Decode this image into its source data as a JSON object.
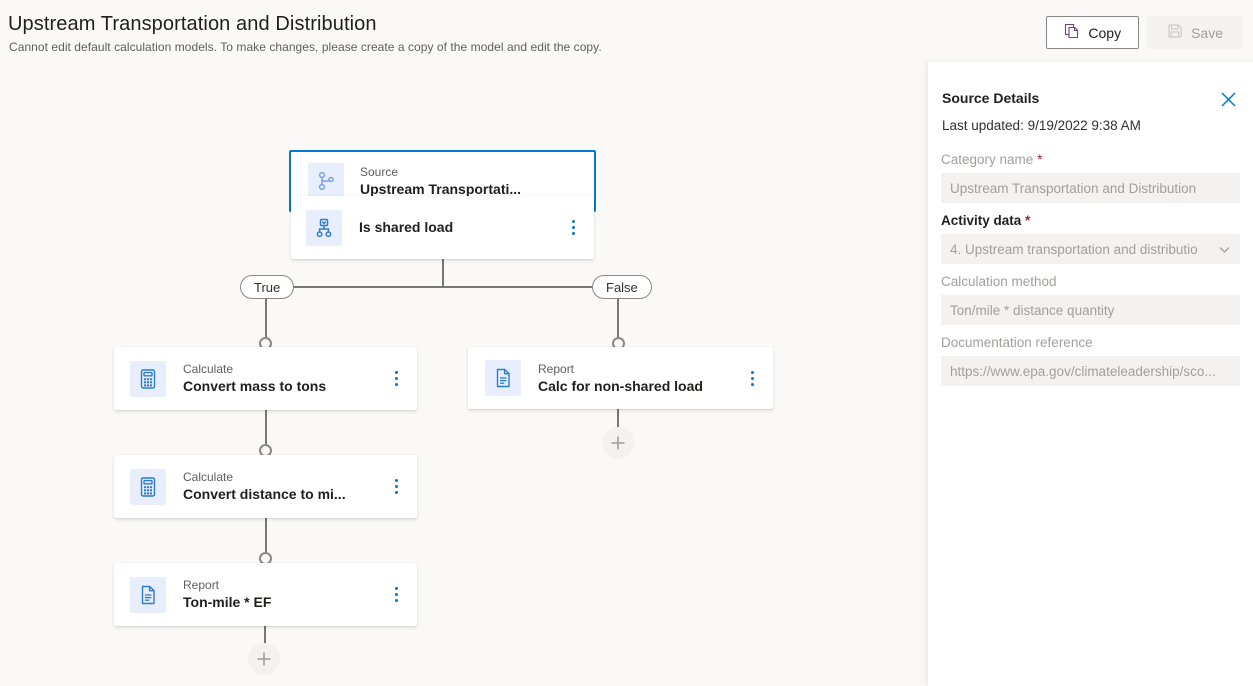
{
  "header": {
    "title": "Upstream Transportation and Distribution",
    "subtitle": "Cannot edit default calculation models. To make changes, please create a copy of the model and edit the copy.",
    "copy_label": "Copy",
    "save_label": "Save",
    "copy_icon": "copy-icon",
    "save_icon": "save-floppy-icon"
  },
  "flow": {
    "nodes": [
      {
        "id": "source",
        "kind": "Source",
        "name": "Upstream Transportati...",
        "icon": "branch-source-icon",
        "selected": true,
        "has_menu": false
      },
      {
        "id": "decision",
        "kind": "",
        "name": "Is shared load",
        "icon": "decision-branch-icon",
        "selected": false,
        "has_menu": true
      },
      {
        "id": "calc1",
        "kind": "Calculate",
        "name": "Convert mass to tons",
        "icon": "calculator-icon",
        "selected": false,
        "has_menu": true
      },
      {
        "id": "calc2",
        "kind": "Calculate",
        "name": "Convert distance to mi...",
        "icon": "calculator-icon",
        "selected": false,
        "has_menu": true
      },
      {
        "id": "report1",
        "kind": "Report",
        "name": "Ton-mile * EF",
        "icon": "document-icon",
        "selected": false,
        "has_menu": true
      },
      {
        "id": "report2",
        "kind": "Report",
        "name": "Calc for non-shared load",
        "icon": "document-icon",
        "selected": false,
        "has_menu": true
      }
    ],
    "branch_true_label": "True",
    "branch_false_label": "False",
    "add_label": "+"
  },
  "panel": {
    "title": "Source Details",
    "close_icon": "close-icon",
    "last_updated": "Last updated: 9/19/2022 9:38 AM",
    "fields": [
      {
        "label": "Category name",
        "required": true,
        "enabled": false,
        "value": "Upstream Transportation and Distribution",
        "type": "text"
      },
      {
        "label": "Activity data",
        "required": true,
        "enabled": true,
        "value": "4. Upstream transportation and distributio",
        "type": "dropdown"
      },
      {
        "label": "Calculation method",
        "required": false,
        "enabled": false,
        "value": "Ton/mile * distance quantity",
        "type": "text"
      },
      {
        "label": "Documentation reference",
        "required": false,
        "enabled": false,
        "value": "https://www.epa.gov/climateleadership/sco...",
        "type": "text"
      }
    ]
  },
  "colors": {
    "accent": "#0078d4",
    "canvas_bg": "#faf9f8",
    "node_icon_bg": "#e8eefb",
    "icon_blue": "#3b7ddd",
    "edge": "#797775",
    "required_red": "#a4262c",
    "copy_icon": "#7a3b86"
  }
}
